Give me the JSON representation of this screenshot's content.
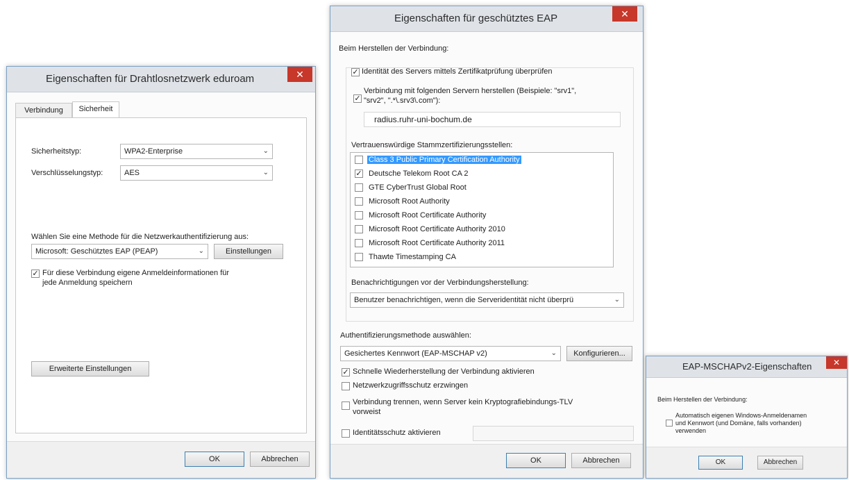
{
  "wifi": {
    "title": "Eigenschaften für Drahtlosnetzwerk eduroam",
    "close": "✕",
    "tabs": [
      "Verbindung",
      "Sicherheit"
    ],
    "security_type_label": "Sicherheitstyp:",
    "security_type_value": "WPA2-Enterprise",
    "encryption_type_label": "Verschlüsselungstyp:",
    "encryption_type_value": "AES",
    "method_label": "Wählen Sie eine Methode für die Netzwerkauthentifizierung aus:",
    "method_value": "Microsoft: Geschütztes EAP (PEAP)",
    "settings_button": "Einstellungen",
    "remember_checked": true,
    "remember_line1": "Für diese Verbindung eigene Anmeldeinformationen für",
    "remember_line2": "jede Anmeldung speichern",
    "advanced_button": "Erweiterte Einstellungen",
    "ok": "OK",
    "cancel": "Abbrechen"
  },
  "peap": {
    "title": "Eigenschaften für geschütztes EAP",
    "close": "✕",
    "connecting_label": "Beim Herstellen der Verbindung:",
    "verify_identity": "Identität des Servers mittels Zertifikatprüfung überprüfen",
    "verify_identity_checked": true,
    "connect_servers_line1": "Verbindung mit folgenden Servern herstellen (Beispiele: \"srv1\",",
    "connect_servers_line2": "\"srv2\", \".*\\.srv3\\.com\"):",
    "connect_servers_checked": true,
    "server_value": "radius.ruhr-uni-bochum.de",
    "trusted_ca_label": "Vertrauenswürdige Stammzertifizierungsstellen:",
    "ca_list": [
      {
        "name": "Class 3 Public Primary Certification Authority",
        "checked": false,
        "selected": true
      },
      {
        "name": "Deutsche Telekom Root CA 2",
        "checked": true,
        "selected": false
      },
      {
        "name": "GTE CyberTrust Global Root",
        "checked": false,
        "selected": false
      },
      {
        "name": "Microsoft Root Authority",
        "checked": false,
        "selected": false
      },
      {
        "name": "Microsoft Root Certificate Authority",
        "checked": false,
        "selected": false
      },
      {
        "name": "Microsoft Root Certificate Authority 2010",
        "checked": false,
        "selected": false
      },
      {
        "name": "Microsoft Root Certificate Authority 2011",
        "checked": false,
        "selected": false
      },
      {
        "name": "Thawte Timestamping CA",
        "checked": false,
        "selected": false
      }
    ],
    "notify_label": "Benachrichtigungen vor der Verbindungsherstellung:",
    "notify_value": "Benutzer benachrichtigen, wenn die Serveridentität nicht überprü",
    "auth_method_label": "Authentifizierungsmethode auswählen:",
    "auth_method_value": "Gesichertes Kennwort (EAP-MSCHAP v2)",
    "configure_button": "Konfigurieren...",
    "fast_reconnect": "Schnelle Wiederherstellung der Verbindung aktivieren",
    "fast_reconnect_checked": true,
    "nap": "Netzwerkzugriffsschutz erzwingen",
    "nap_checked": false,
    "disconnect_line1": "Verbindung trennen, wenn Server kein Kryptografiebindungs-TLV",
    "disconnect_line2": "vorweist",
    "disconnect_checked": false,
    "identity_privacy": "Identitätsschutz aktivieren",
    "identity_privacy_checked": false,
    "ok": "OK",
    "cancel": "Abbrechen"
  },
  "mschap": {
    "title": "EAP-MSCHAPv2-Eigenschaften",
    "close": "✕",
    "connecting_label": "Beim Herstellen der Verbindung:",
    "auto_line1": "Automatisch eigenen Windows-Anmeldenamen",
    "auto_line2": "und Kennwort (und Domäne, falls vorhanden)",
    "auto_line3": "verwenden",
    "auto_checked": false,
    "ok": "OK",
    "cancel": "Abbrechen"
  }
}
